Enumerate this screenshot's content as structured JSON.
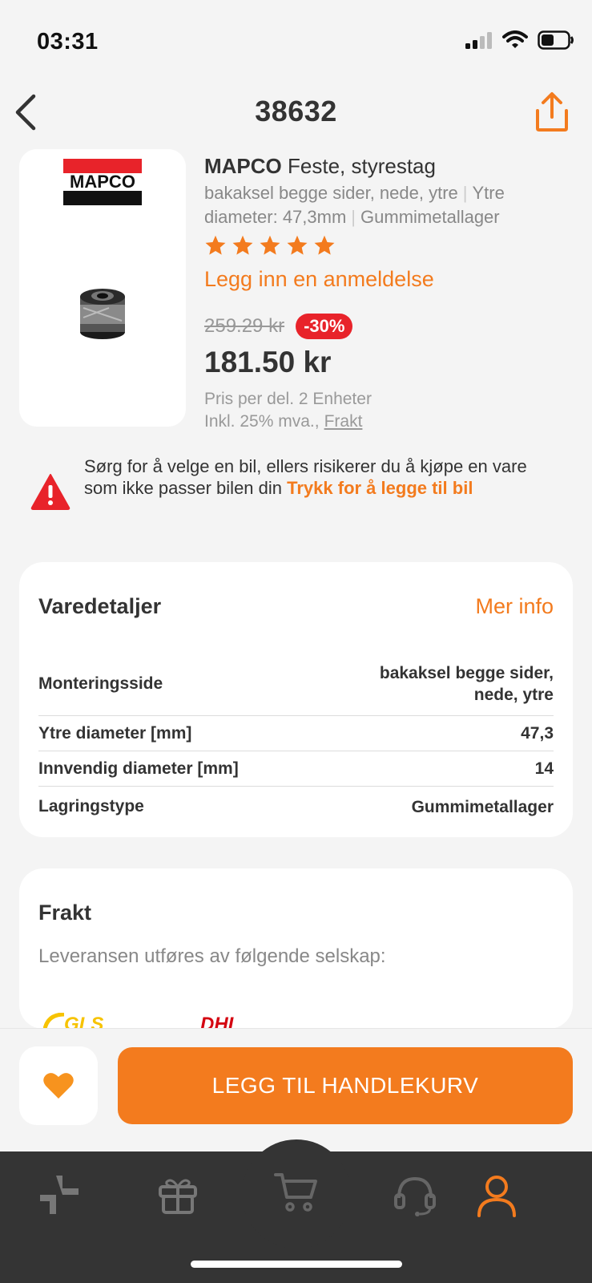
{
  "status": {
    "time": "03:31",
    "icons": [
      "signal-icon",
      "wifi-icon",
      "battery-icon"
    ]
  },
  "nav": {
    "title": "38632",
    "back_icon": "chevron-left-icon",
    "share_icon": "share-icon"
  },
  "product": {
    "brand": "MAPCO",
    "name": "Feste, styrestag",
    "desc_1": "bakaksel begge sider, nede, ytre",
    "desc_2": "Ytre",
    "desc_3": "diameter: 47,3mm",
    "desc_4": "Gummimetallager",
    "rating": 5,
    "review_link": "Legg inn en anmeldelse",
    "old_price": "259.29 kr",
    "discount": "-30%",
    "price": "181.50 kr",
    "unit_info": "Pris per del. 2 Enheter",
    "tax_info": "Inkl. 25% mva.,",
    "shipping_link": "Frakt",
    "logo_text": "MAPCO"
  },
  "warning": {
    "text": "Sørg for å velge en bil, ellers risikerer du å kjøpe en vare som ikke passer bilen din",
    "cta": "Trykk for å legge til bil"
  },
  "details": {
    "title": "Varedetaljer",
    "more": "Mer info",
    "rows": [
      {
        "key": "Monteringsside",
        "value": "bakaksel begge sider, nede, ytre"
      },
      {
        "key": "Ytre diameter [mm]",
        "value": "47,3"
      },
      {
        "key": "Innvendig diameter [mm]",
        "value": "14"
      },
      {
        "key": "Lagringstype",
        "value": "Gummimetallager"
      }
    ]
  },
  "shipping": {
    "title": "Frakt",
    "desc": "Leveransen utføres av følgende selskap:",
    "carriers": [
      "GLS",
      "DHL"
    ]
  },
  "actions": {
    "add_to_cart": "LEGG TIL HANDLEKURV"
  },
  "colors": {
    "accent": "#f37b1e",
    "discount": "#e8232a",
    "tabbar": "#343434"
  }
}
